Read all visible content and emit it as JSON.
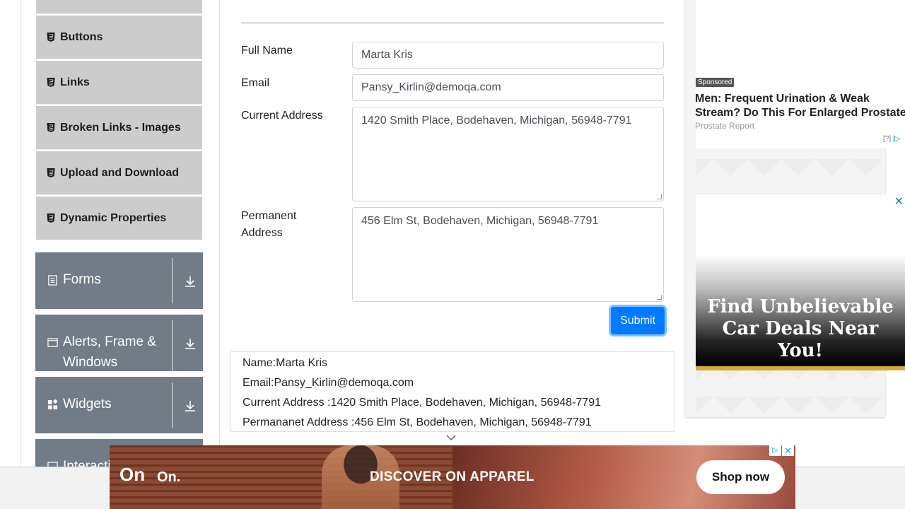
{
  "sidebar": {
    "elements_items": [
      {
        "label": "Buttons"
      },
      {
        "label": "Links"
      },
      {
        "label": "Broken Links - Images"
      },
      {
        "label": "Upload and Download"
      },
      {
        "label": "Dynamic Properties"
      }
    ],
    "groups": [
      {
        "label": "Forms",
        "icon": "document-icon"
      },
      {
        "label": "Alerts, Frame &",
        "label2": "Windows",
        "icon": "window-icon"
      },
      {
        "label": "Widgets",
        "icon": "widgets-icon"
      },
      {
        "label": "Interacti",
        "icon": "interactions-icon"
      }
    ]
  },
  "form": {
    "full_name_label": "Full Name",
    "full_name_value": "Marta Kris",
    "email_label": "Email",
    "email_value": "Pansy_Kirlin@demoqa.com",
    "current_address_label": "Current Address",
    "current_address_value": "1420 Smith Place, Bodehaven, Michigan, 56948-7791",
    "permanent_address_label_1": "Permanent",
    "permanent_address_label_2": "Address",
    "permanent_address_value": "456 Elm St, Bodehaven, Michigan, 56948-7791",
    "submit_label": "Submit"
  },
  "output": {
    "name": "Name:Marta Kris",
    "email": "Email:Pansy_Kirlin@demoqa.com",
    "current_address": "Current Address :1420 Smith Place, Bodehaven, Michigan, 56948-7791",
    "permanent_address": "Permananet Address :456 Elm St, Bodehaven, Michigan, 56948-7791"
  },
  "right_ad": {
    "sponsored": "Sponsored",
    "headline_1": "Men: Frequent Urination & Weak",
    "headline_2": "Stream? Do This For Enlarged Prostate",
    "source": "Prostate Report",
    "help": "[?]",
    "car_line_1": "Find Unbelievable",
    "car_line_2": "Car Deals Near",
    "car_line_3": "You!",
    "close": "✕"
  },
  "bottom_banner": {
    "logo": "On",
    "brand": "On.",
    "headline": "DISCOVER ON APPAREL",
    "cta": "Shop now",
    "adchoices": "▷",
    "close": "✕"
  },
  "colors": {
    "primary": "#007bff",
    "sidebar_group": "#727c87",
    "sidebar_item": "#cccccc"
  }
}
